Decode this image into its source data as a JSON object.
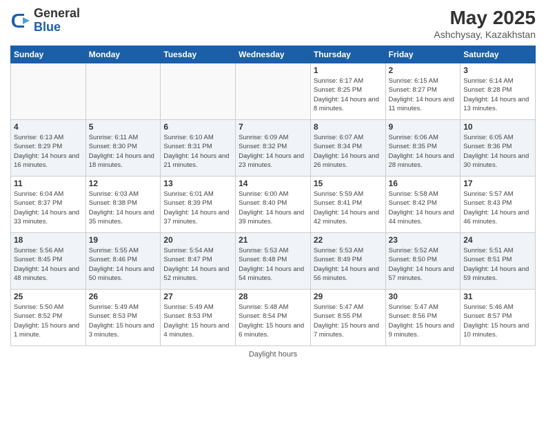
{
  "logo": {
    "general": "General",
    "blue": "Blue"
  },
  "title": "May 2025",
  "subtitle": "Ashchysay, Kazakhstan",
  "days_of_week": [
    "Sunday",
    "Monday",
    "Tuesday",
    "Wednesday",
    "Thursday",
    "Friday",
    "Saturday"
  ],
  "footer_text": "Daylight hours",
  "weeks": [
    [
      {
        "day": "",
        "info": ""
      },
      {
        "day": "",
        "info": ""
      },
      {
        "day": "",
        "info": ""
      },
      {
        "day": "",
        "info": ""
      },
      {
        "day": "1",
        "info": "Sunrise: 6:17 AM\nSunset: 8:25 PM\nDaylight: 14 hours\nand 8 minutes."
      },
      {
        "day": "2",
        "info": "Sunrise: 6:15 AM\nSunset: 8:27 PM\nDaylight: 14 hours\nand 11 minutes."
      },
      {
        "day": "3",
        "info": "Sunrise: 6:14 AM\nSunset: 8:28 PM\nDaylight: 14 hours\nand 13 minutes."
      }
    ],
    [
      {
        "day": "4",
        "info": "Sunrise: 6:13 AM\nSunset: 8:29 PM\nDaylight: 14 hours\nand 16 minutes."
      },
      {
        "day": "5",
        "info": "Sunrise: 6:11 AM\nSunset: 8:30 PM\nDaylight: 14 hours\nand 18 minutes."
      },
      {
        "day": "6",
        "info": "Sunrise: 6:10 AM\nSunset: 8:31 PM\nDaylight: 14 hours\nand 21 minutes."
      },
      {
        "day": "7",
        "info": "Sunrise: 6:09 AM\nSunset: 8:32 PM\nDaylight: 14 hours\nand 23 minutes."
      },
      {
        "day": "8",
        "info": "Sunrise: 6:07 AM\nSunset: 8:34 PM\nDaylight: 14 hours\nand 26 minutes."
      },
      {
        "day": "9",
        "info": "Sunrise: 6:06 AM\nSunset: 8:35 PM\nDaylight: 14 hours\nand 28 minutes."
      },
      {
        "day": "10",
        "info": "Sunrise: 6:05 AM\nSunset: 8:36 PM\nDaylight: 14 hours\nand 30 minutes."
      }
    ],
    [
      {
        "day": "11",
        "info": "Sunrise: 6:04 AM\nSunset: 8:37 PM\nDaylight: 14 hours\nand 33 minutes."
      },
      {
        "day": "12",
        "info": "Sunrise: 6:03 AM\nSunset: 8:38 PM\nDaylight: 14 hours\nand 35 minutes."
      },
      {
        "day": "13",
        "info": "Sunrise: 6:01 AM\nSunset: 8:39 PM\nDaylight: 14 hours\nand 37 minutes."
      },
      {
        "day": "14",
        "info": "Sunrise: 6:00 AM\nSunset: 8:40 PM\nDaylight: 14 hours\nand 39 minutes."
      },
      {
        "day": "15",
        "info": "Sunrise: 5:59 AM\nSunset: 8:41 PM\nDaylight: 14 hours\nand 42 minutes."
      },
      {
        "day": "16",
        "info": "Sunrise: 5:58 AM\nSunset: 8:42 PM\nDaylight: 14 hours\nand 44 minutes."
      },
      {
        "day": "17",
        "info": "Sunrise: 5:57 AM\nSunset: 8:43 PM\nDaylight: 14 hours\nand 46 minutes."
      }
    ],
    [
      {
        "day": "18",
        "info": "Sunrise: 5:56 AM\nSunset: 8:45 PM\nDaylight: 14 hours\nand 48 minutes."
      },
      {
        "day": "19",
        "info": "Sunrise: 5:55 AM\nSunset: 8:46 PM\nDaylight: 14 hours\nand 50 minutes."
      },
      {
        "day": "20",
        "info": "Sunrise: 5:54 AM\nSunset: 8:47 PM\nDaylight: 14 hours\nand 52 minutes."
      },
      {
        "day": "21",
        "info": "Sunrise: 5:53 AM\nSunset: 8:48 PM\nDaylight: 14 hours\nand 54 minutes."
      },
      {
        "day": "22",
        "info": "Sunrise: 5:53 AM\nSunset: 8:49 PM\nDaylight: 14 hours\nand 56 minutes."
      },
      {
        "day": "23",
        "info": "Sunrise: 5:52 AM\nSunset: 8:50 PM\nDaylight: 14 hours\nand 57 minutes."
      },
      {
        "day": "24",
        "info": "Sunrise: 5:51 AM\nSunset: 8:51 PM\nDaylight: 14 hours\nand 59 minutes."
      }
    ],
    [
      {
        "day": "25",
        "info": "Sunrise: 5:50 AM\nSunset: 8:52 PM\nDaylight: 15 hours\nand 1 minute."
      },
      {
        "day": "26",
        "info": "Sunrise: 5:49 AM\nSunset: 8:53 PM\nDaylight: 15 hours\nand 3 minutes."
      },
      {
        "day": "27",
        "info": "Sunrise: 5:49 AM\nSunset: 8:53 PM\nDaylight: 15 hours\nand 4 minutes."
      },
      {
        "day": "28",
        "info": "Sunrise: 5:48 AM\nSunset: 8:54 PM\nDaylight: 15 hours\nand 6 minutes."
      },
      {
        "day": "29",
        "info": "Sunrise: 5:47 AM\nSunset: 8:55 PM\nDaylight: 15 hours\nand 7 minutes."
      },
      {
        "day": "30",
        "info": "Sunrise: 5:47 AM\nSunset: 8:56 PM\nDaylight: 15 hours\nand 9 minutes."
      },
      {
        "day": "31",
        "info": "Sunrise: 5:46 AM\nSunset: 8:57 PM\nDaylight: 15 hours\nand 10 minutes."
      }
    ]
  ]
}
